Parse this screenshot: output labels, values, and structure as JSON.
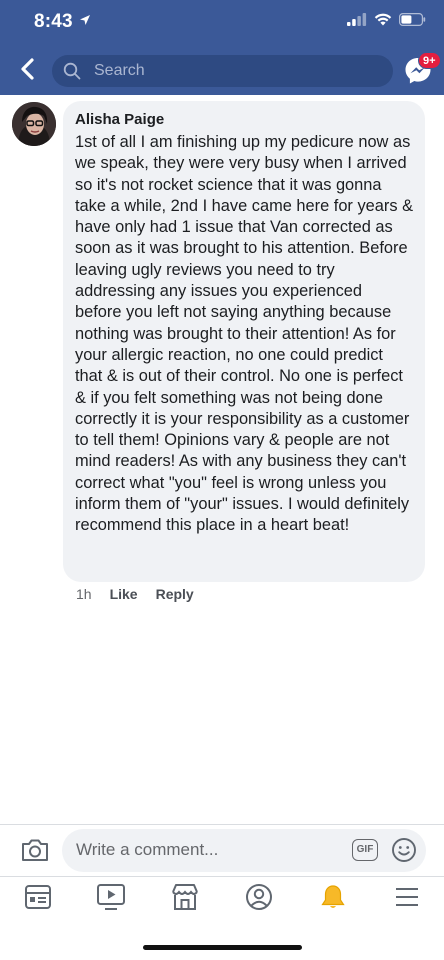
{
  "status_bar": {
    "time": "8:43"
  },
  "header": {
    "search_placeholder": "Search",
    "messenger_badge": "9+"
  },
  "comment": {
    "author": "Alisha Paige",
    "text": "1st of all I am finishing up my pedicure now as we speak, they were very busy when I arrived so it's not rocket science that it was gonna take a while, 2nd I have came here for years & have only had 1 issue that Van corrected as soon as it was brought to his attention. Before leaving ugly reviews you need to try addressing any issues you experienced before you left not saying anything because nothing was brought to their attention! As for your allergic reaction, no one could predict that & is out of their control. No one is perfect & if you felt something was not being done correctly it is your responsibility as a customer to tell them! Opinions vary & people are not mind readers! As with any business they can't correct what \"you\" feel is wrong unless you inform them of \"your\" issues. I would definitely recommend this place in a heart beat!",
    "timestamp": "1h",
    "like_label": "Like",
    "reply_label": "Reply"
  },
  "composer": {
    "placeholder": "Write a comment...",
    "gif_label": "GIF"
  },
  "icons": [
    "location-arrow-icon",
    "signal-icon",
    "wifi-icon",
    "battery-icon",
    "back-arrow-icon",
    "search-icon",
    "messenger-icon",
    "camera-icon",
    "emoji-icon",
    "news-feed-icon",
    "watch-icon",
    "marketplace-icon",
    "profile-icon",
    "notifications-icon",
    "menu-icon"
  ],
  "colors": {
    "header_blue": "#3b5998",
    "notification_active": "#f7b928",
    "badge_red": "#e41e3f"
  }
}
